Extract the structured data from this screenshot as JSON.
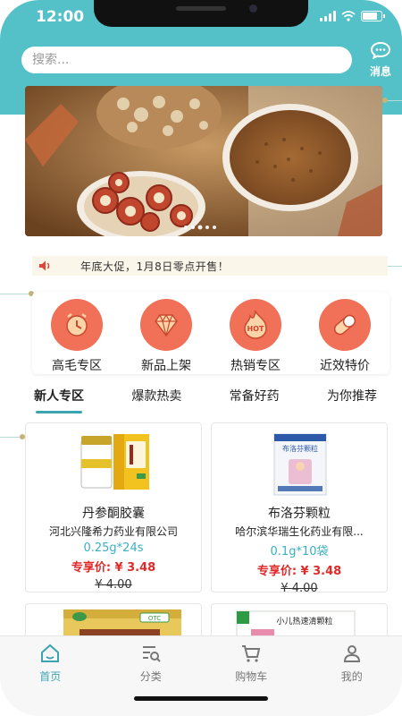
{
  "status_bar": {
    "time": "12:00"
  },
  "search": {
    "placeholder": "搜索..."
  },
  "header": {
    "messages_label": "消息"
  },
  "notice": {
    "text": "年底大促，1月8日零点开售！"
  },
  "categories": [
    {
      "label": "高毛专区",
      "icon": "clock-icon"
    },
    {
      "label": "新品上架",
      "icon": "diamond-icon"
    },
    {
      "label": "热销专区",
      "icon": "hot-icon"
    },
    {
      "label": "近效特价",
      "icon": "pill-icon"
    }
  ],
  "tabs": [
    {
      "label": "新人专区",
      "active": true
    },
    {
      "label": "爆款热卖",
      "active": false
    },
    {
      "label": "常备好药",
      "active": false
    },
    {
      "label": "为你推荐",
      "active": false
    }
  ],
  "products": [
    {
      "name": "丹参酮胶囊",
      "maker": "河北兴隆希力药业有限公司",
      "spec": "0.25g*24s",
      "price": "专享价: ¥ 3.48",
      "original": "¥ 4.00"
    },
    {
      "name": "布洛芬颗粒",
      "maker": "哈尔滨华瑞生化药业有限...",
      "spec": "0.1g*10袋",
      "price": "专享价: ¥ 3.48",
      "original": "¥ 4.00"
    }
  ],
  "product_images": {
    "box2_label": "布洛芬颗粒",
    "box3_label": "OTC",
    "box4_label": "小儿热速清颗粒"
  },
  "bottom_nav": [
    {
      "label": "首页",
      "icon": "home-icon",
      "active": true
    },
    {
      "label": "分类",
      "icon": "category-icon",
      "active": false
    },
    {
      "label": "购物车",
      "icon": "cart-icon",
      "active": false
    },
    {
      "label": "我的",
      "icon": "user-icon",
      "active": false
    }
  ],
  "colors": {
    "accent": "#3aa4b0",
    "header": "#54c1c9",
    "price": "#e02a2a",
    "category": "#f07058"
  }
}
